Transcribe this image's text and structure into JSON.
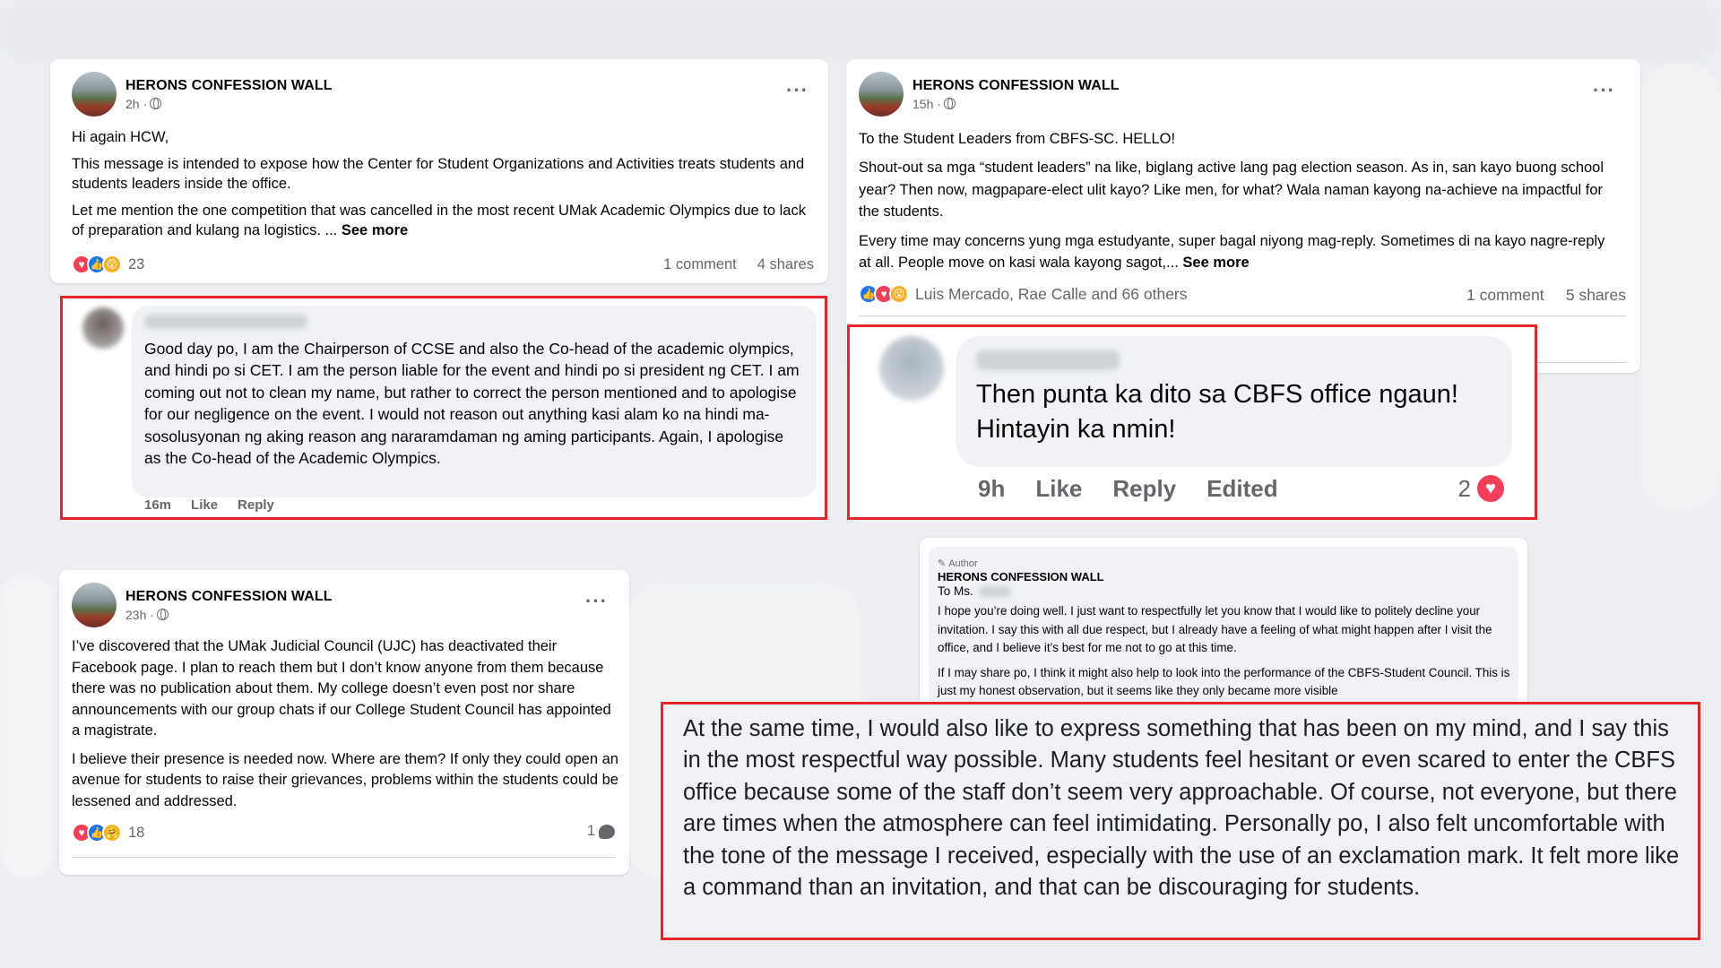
{
  "page_name": "HERONS CONFESSION WALL",
  "post1": {
    "time": "2h ·",
    "paragraphs": [
      "Hi again HCW,",
      "This message is intended to expose how the Center for Student Organizations and Activities treats students and students leaders inside the office.",
      "Let me mention the one competition that was cancelled in the most recent UMak Academic Olympics due to lack of preparation and kulang na logistics. ..."
    ],
    "see_more": "See more",
    "reaction_count": "23",
    "comments": "1 comment",
    "shares": "4 shares",
    "comment": {
      "text": "Good day po, I am the Chairperson of CCSE and also the Co-head of the academic olympics, and hindi po si CET. I am the person liable for the event and hindi po si president ng CET. I am coming out not to clean my name, but rather to correct the person mentioned and to apologise for our negligence on the event. I would not reason out anything kasi alam ko na hindi ma-sosolusyonan ng aking reason ang nararamdaman ng aming participants. Again, I apologise as the Co-head of the Academic Olympics.",
      "time": "16m",
      "like": "Like",
      "reply": "Reply"
    }
  },
  "post2": {
    "time": "15h ·",
    "paragraphs": [
      "To the Student Leaders from CBFS-SC. HELLO!",
      "Shout-out sa mga “student leaders” na like, biglang active lang pag election season. As in, san kayo buong school year? Then now, magpapare-elect ulit kayo? Like men, for what? Wala naman kayong na-achieve na impactful for the students.",
      "Every time may concerns yung mga estudyante, super bagal niyong mag-reply. Sometimes di na kayo nagre-reply at all. People move on kasi wala kayong sagot,..."
    ],
    "see_more": "See more",
    "reactors": "Luis Mercado, Rae Calle and 66 others",
    "comments": "1 comment",
    "shares": "5 shares",
    "comment": {
      "text": "Then punta ka dito sa CBFS office ngaun! Hintayin ka nmin!",
      "time": "9h",
      "like": "Like",
      "reply": "Reply",
      "edited": "Edited",
      "reaction_count": "2"
    }
  },
  "post3": {
    "time": "23h ·",
    "paragraphs": [
      "I’ve discovered that the UMak Judicial Council (UJC) has deactivated their Facebook page. I plan to reach them but I don’t know anyone from them because there was no publication about them. My college doesn’t even post nor share announcements with our group chats if our College Student Council has appointed a magistrate.",
      "I believe their presence is needed now. Where are them? If only they could open an avenue for students to raise their grievances, problems within the students could be lessened and addressed."
    ],
    "reaction_count": "18",
    "comment_count": "1"
  },
  "author_reply": {
    "badge": "Author",
    "name": "HERONS CONFESSION WALL",
    "salutation": "To Ms.",
    "paragraphs": [
      "I hope you’re doing well. I just want to respectfully let you know that I would like to politely decline your invitation. I say this with all due respect, but I already have a feeling of what might happen after I visit the office, and I believe it’s best for me not to go at this time.",
      "If I may share po, I think it might also help to look into the performance of the CBFS-Student Council. This is just my honest observation, but it seems like they only became more visible"
    ],
    "highlight": "At the same time, I would also like to express something that has been on my mind, and I say this in the most respectful way possible. Many students feel hesitant or even scared to enter the CBFS office because some of the staff don’t seem very approachable. Of course, not everyone, but there are times when the atmosphere can feel intimidating. Personally po, I also felt uncomfortable with the tone of the message I received, especially with the use of an exclamation mark. It felt more like a command than an invitation, and that can be discouraging for students."
  },
  "colors": {
    "highlight_border": "#e4252a",
    "secondary_text": "#65676b",
    "bubble": "#f0f2f5",
    "love": "#f33e58",
    "like": "#1877f2"
  }
}
